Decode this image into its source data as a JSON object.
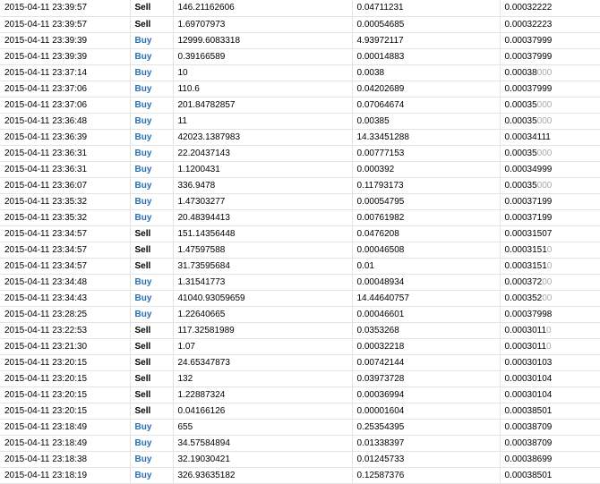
{
  "colors": {
    "buy": "#2a6fb0",
    "sell": "#000000",
    "faded_zero": "#aaaaaa",
    "grid": "#e3e3e3"
  },
  "trades": [
    {
      "date": "2015-04-11 23:39:57",
      "type": "Sell",
      "amount": "146.21162606",
      "total": "0.04711231",
      "price": "0.00032222",
      "price_tail": ""
    },
    {
      "date": "2015-04-11 23:39:57",
      "type": "Sell",
      "amount": "1.69707973",
      "total": "0.00054685",
      "price": "0.00032223",
      "price_tail": ""
    },
    {
      "date": "2015-04-11 23:39:39",
      "type": "Buy",
      "amount": "12999.6083318",
      "total": "4.93972117",
      "price": "0.00037999",
      "price_tail": ""
    },
    {
      "date": "2015-04-11 23:39:39",
      "type": "Buy",
      "amount": "0.39166589",
      "total": "0.00014883",
      "price": "0.00037999",
      "price_tail": ""
    },
    {
      "date": "2015-04-11 23:37:14",
      "type": "Buy",
      "amount": "10",
      "total": "0.0038",
      "price": "0.00038",
      "price_tail": "000"
    },
    {
      "date": "2015-04-11 23:37:06",
      "type": "Buy",
      "amount": "110.6",
      "total": "0.04202689",
      "price": "0.00037999",
      "price_tail": ""
    },
    {
      "date": "2015-04-11 23:37:06",
      "type": "Buy",
      "amount": "201.84782857",
      "total": "0.07064674",
      "price": "0.00035",
      "price_tail": "000"
    },
    {
      "date": "2015-04-11 23:36:48",
      "type": "Buy",
      "amount": "11",
      "total": "0.00385",
      "price": "0.00035",
      "price_tail": "000"
    },
    {
      "date": "2015-04-11 23:36:39",
      "type": "Buy",
      "amount": "42023.1387983",
      "total": "14.33451288",
      "price": "0.00034111",
      "price_tail": ""
    },
    {
      "date": "2015-04-11 23:36:31",
      "type": "Buy",
      "amount": "22.20437143",
      "total": "0.00777153",
      "price": "0.00035",
      "price_tail": "000"
    },
    {
      "date": "2015-04-11 23:36:31",
      "type": "Buy",
      "amount": "1.1200431",
      "total": "0.000392",
      "price": "0.00034999",
      "price_tail": ""
    },
    {
      "date": "2015-04-11 23:36:07",
      "type": "Buy",
      "amount": "336.9478",
      "total": "0.11793173",
      "price": "0.00035",
      "price_tail": "000"
    },
    {
      "date": "2015-04-11 23:35:32",
      "type": "Buy",
      "amount": "1.47303277",
      "total": "0.00054795",
      "price": "0.00037199",
      "price_tail": ""
    },
    {
      "date": "2015-04-11 23:35:32",
      "type": "Buy",
      "amount": "20.48394413",
      "total": "0.00761982",
      "price": "0.00037199",
      "price_tail": ""
    },
    {
      "date": "2015-04-11 23:34:57",
      "type": "Sell",
      "amount": "151.14356448",
      "total": "0.0476208",
      "price": "0.00031507",
      "price_tail": ""
    },
    {
      "date": "2015-04-11 23:34:57",
      "type": "Sell",
      "amount": "1.47597588",
      "total": "0.00046508",
      "price": "0.0003151",
      "price_tail": "0"
    },
    {
      "date": "2015-04-11 23:34:57",
      "type": "Sell",
      "amount": "31.73595684",
      "total": "0.01",
      "price": "0.0003151",
      "price_tail": "0"
    },
    {
      "date": "2015-04-11 23:34:48",
      "type": "Buy",
      "amount": "1.31541773",
      "total": "0.00048934",
      "price": "0.000372",
      "price_tail": "00"
    },
    {
      "date": "2015-04-11 23:34:43",
      "type": "Buy",
      "amount": "41040.93059659",
      "total": "14.44640757",
      "price": "0.000352",
      "price_tail": "00"
    },
    {
      "date": "2015-04-11 23:28:25",
      "type": "Buy",
      "amount": "1.22640665",
      "total": "0.00046601",
      "price": "0.00037998",
      "price_tail": ""
    },
    {
      "date": "2015-04-11 23:22:53",
      "type": "Sell",
      "amount": "117.32581989",
      "total": "0.0353268",
      "price": "0.0003011",
      "price_tail": "0"
    },
    {
      "date": "2015-04-11 23:21:30",
      "type": "Sell",
      "amount": "1.07",
      "total": "0.00032218",
      "price": "0.0003011",
      "price_tail": "0"
    },
    {
      "date": "2015-04-11 23:20:15",
      "type": "Sell",
      "amount": "24.65347873",
      "total": "0.00742144",
      "price": "0.00030103",
      "price_tail": ""
    },
    {
      "date": "2015-04-11 23:20:15",
      "type": "Sell",
      "amount": "132",
      "total": "0.03973728",
      "price": "0.00030104",
      "price_tail": ""
    },
    {
      "date": "2015-04-11 23:20:15",
      "type": "Sell",
      "amount": "1.22887324",
      "total": "0.00036994",
      "price": "0.00030104",
      "price_tail": ""
    },
    {
      "date": "2015-04-11 23:20:15",
      "type": "Sell",
      "amount": "0.04166126",
      "total": "0.00001604",
      "price": "0.00038501",
      "price_tail": ""
    },
    {
      "date": "2015-04-11 23:18:49",
      "type": "Buy",
      "amount": "655",
      "total": "0.25354395",
      "price": "0.00038709",
      "price_tail": ""
    },
    {
      "date": "2015-04-11 23:18:49",
      "type": "Buy",
      "amount": "34.57584894",
      "total": "0.01338397",
      "price": "0.00038709",
      "price_tail": ""
    },
    {
      "date": "2015-04-11 23:18:38",
      "type": "Buy",
      "amount": "32.19030421",
      "total": "0.01245733",
      "price": "0.00038699",
      "price_tail": ""
    },
    {
      "date": "2015-04-11 23:18:19",
      "type": "Buy",
      "amount": "326.93635182",
      "total": "0.12587376",
      "price": "0.00038501",
      "price_tail": ""
    }
  ]
}
